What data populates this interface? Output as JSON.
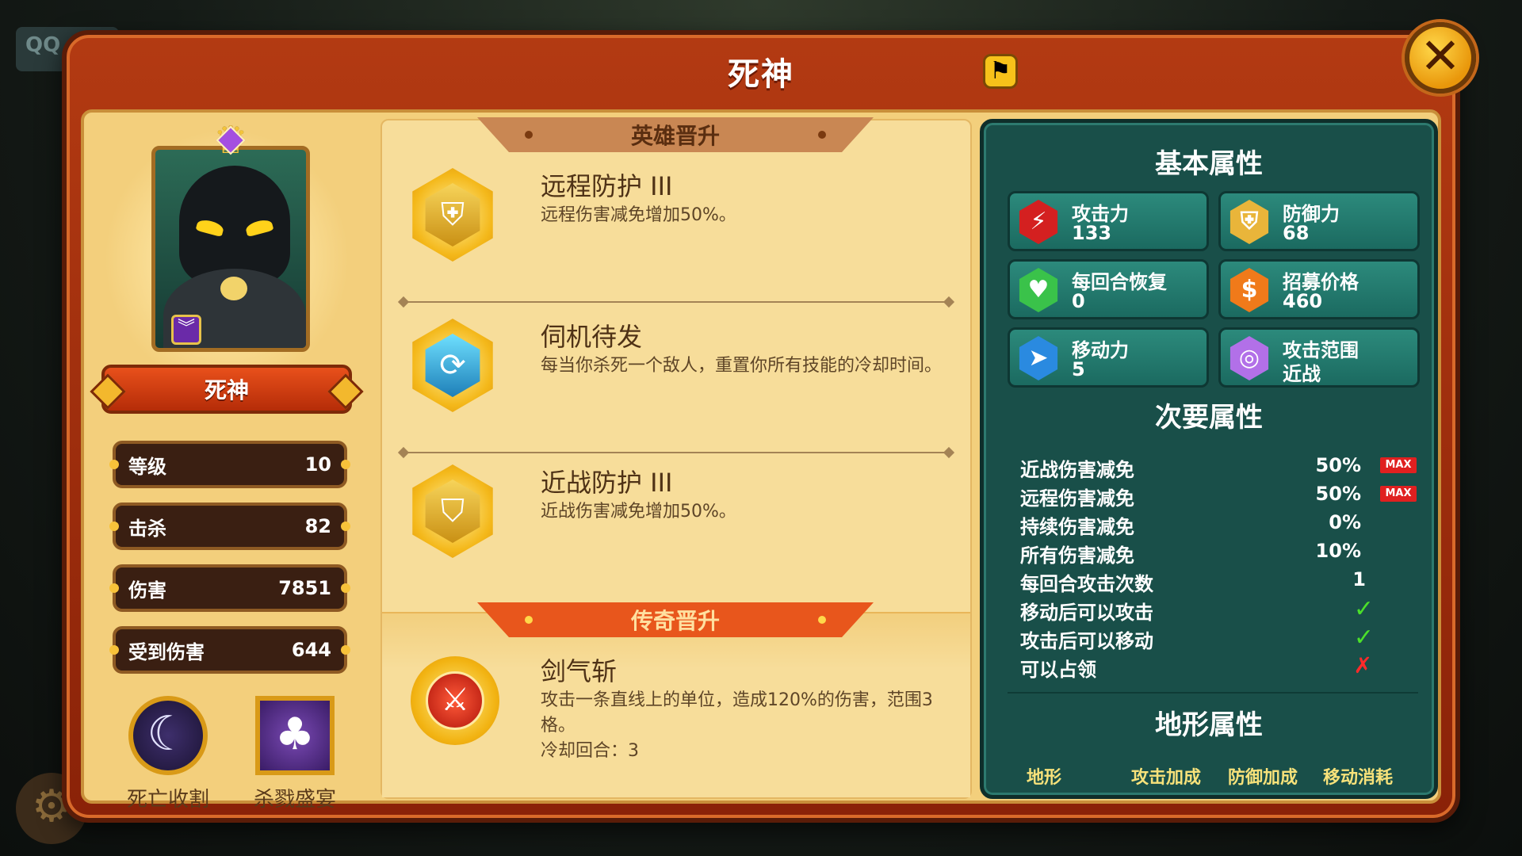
{
  "background": {
    "tab_text": "QQ",
    "gear_icon": "gear-icon"
  },
  "window": {
    "title": "死神",
    "close_icon": "close-icon",
    "title_icon": "flag-icon"
  },
  "hero": {
    "name": "死神",
    "stats": [
      {
        "label": "等级",
        "value": "10"
      },
      {
        "label": "击杀",
        "value": "82"
      },
      {
        "label": "伤害",
        "value": "7851"
      },
      {
        "label": "受到伤害",
        "value": "644"
      }
    ],
    "skills": [
      {
        "name": "死亡收割",
        "icon": "scythe-icon"
      },
      {
        "name": "杀戮盛宴",
        "icon": "feast-icon"
      }
    ]
  },
  "promotion": {
    "title": "英雄晋升",
    "items": [
      {
        "name": "远程防护 III",
        "desc": "远程伤害减免增加50%。",
        "icon": "ranged-shield-icon"
      },
      {
        "name": "伺机待发",
        "desc": "每当你杀死一个敌人，重置你所有技能的冷却时间。",
        "icon": "sword-reset-icon"
      },
      {
        "name": "近战防护 III",
        "desc": "近战伤害减免增加50%。",
        "icon": "melee-shield-icon"
      }
    ]
  },
  "legend": {
    "title": "传奇晋升",
    "name": "剑气斩",
    "desc": "攻击一条直线上的单位，造成120%的伤害，范围3格。",
    "cooldown": "冷却回合：3",
    "icon": "sword-slash-icon"
  },
  "basic": {
    "title": "基本属性",
    "cards": [
      {
        "label": "攻击力",
        "value": "133",
        "icon": "attack-icon",
        "color": "#d42020"
      },
      {
        "label": "防御力",
        "value": "68",
        "icon": "defense-icon",
        "color": "#e9b53a"
      },
      {
        "label": "每回合恢复",
        "value": "0",
        "icon": "heal-icon",
        "color": "#3ac24a"
      },
      {
        "label": "招募价格",
        "value": "460",
        "icon": "cost-icon",
        "color": "#f07a1a"
      },
      {
        "label": "移动力",
        "value": "5",
        "icon": "move-icon",
        "color": "#2a8ae0"
      },
      {
        "label": "攻击范围",
        "value": "近战",
        "icon": "range-icon",
        "color": "#b270e8"
      }
    ]
  },
  "secondary": {
    "title": "次要属性",
    "rows": [
      {
        "label": "近战伤害减免",
        "value": "50%",
        "max": "MAX"
      },
      {
        "label": "远程伤害减免",
        "value": "50%",
        "max": "MAX"
      },
      {
        "label": "持续伤害减免",
        "value": "0%"
      },
      {
        "label": "所有伤害减免",
        "value": "10%"
      },
      {
        "label": "每回合攻击次数",
        "value": "1"
      },
      {
        "label": "移动后可以攻击",
        "mark": "✓"
      },
      {
        "label": "攻击后可以移动",
        "mark": "✓"
      },
      {
        "label": "可以占领",
        "mark": "✗"
      }
    ]
  },
  "terrain": {
    "title": "地形属性",
    "headers": [
      "地形",
      "攻击加成",
      "防御加成",
      "移动消耗"
    ]
  }
}
